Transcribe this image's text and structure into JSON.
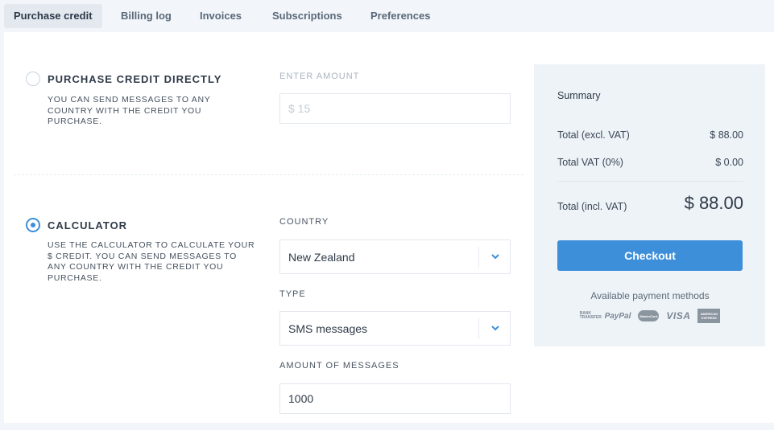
{
  "tabs": [
    {
      "label": "Purchase credit",
      "active": true
    },
    {
      "label": "Billing log"
    },
    {
      "label": "Invoices"
    },
    {
      "label": "Subscriptions"
    },
    {
      "label": "Preferences"
    }
  ],
  "direct": {
    "title": "PURCHASE CREDIT DIRECTLY",
    "description": "YOU CAN SEND MESSAGES TO ANY COUNTRY WITH THE CREDIT YOU PURCHASE.",
    "amount_label": "ENTER AMOUNT",
    "amount_placeholder": "$ 15",
    "selected": false
  },
  "calculator": {
    "title": "CALCULATOR",
    "description": "USE THE CALCULATOR TO CALCULATE YOUR $ CREDIT. YOU CAN SEND MESSAGES TO ANY COUNTRY WITH THE CREDIT YOU PURCHASE.",
    "selected": true,
    "country_label": "COUNTRY",
    "country_value": "New Zealand",
    "type_label": "TYPE",
    "type_value": "SMS messages",
    "amount_label": "AMOUNT OF MESSAGES",
    "amount_value": "1000"
  },
  "summary": {
    "title": "Summary",
    "excl_label": "Total (excl. VAT)",
    "excl_value": "$ 88.00",
    "vat_label": "Total VAT (0%)",
    "vat_value": "$ 0.00",
    "incl_label": "Total (incl. VAT)",
    "incl_value": "$ 88.00",
    "checkout_label": "Checkout",
    "payment_title": "Available payment methods",
    "payment_methods": {
      "bank": "BANK TRANSFER",
      "paypal": "PayPal",
      "mastercard": "MasterCard",
      "visa": "VISA",
      "amex": "AMERICAN EXPRESS"
    }
  },
  "colors": {
    "accent": "#3d8fd9",
    "background": "#f2f6fa",
    "summary_bg": "#eef3f8"
  },
  "icons": {
    "select_chevron": "chevron-down-icon"
  }
}
